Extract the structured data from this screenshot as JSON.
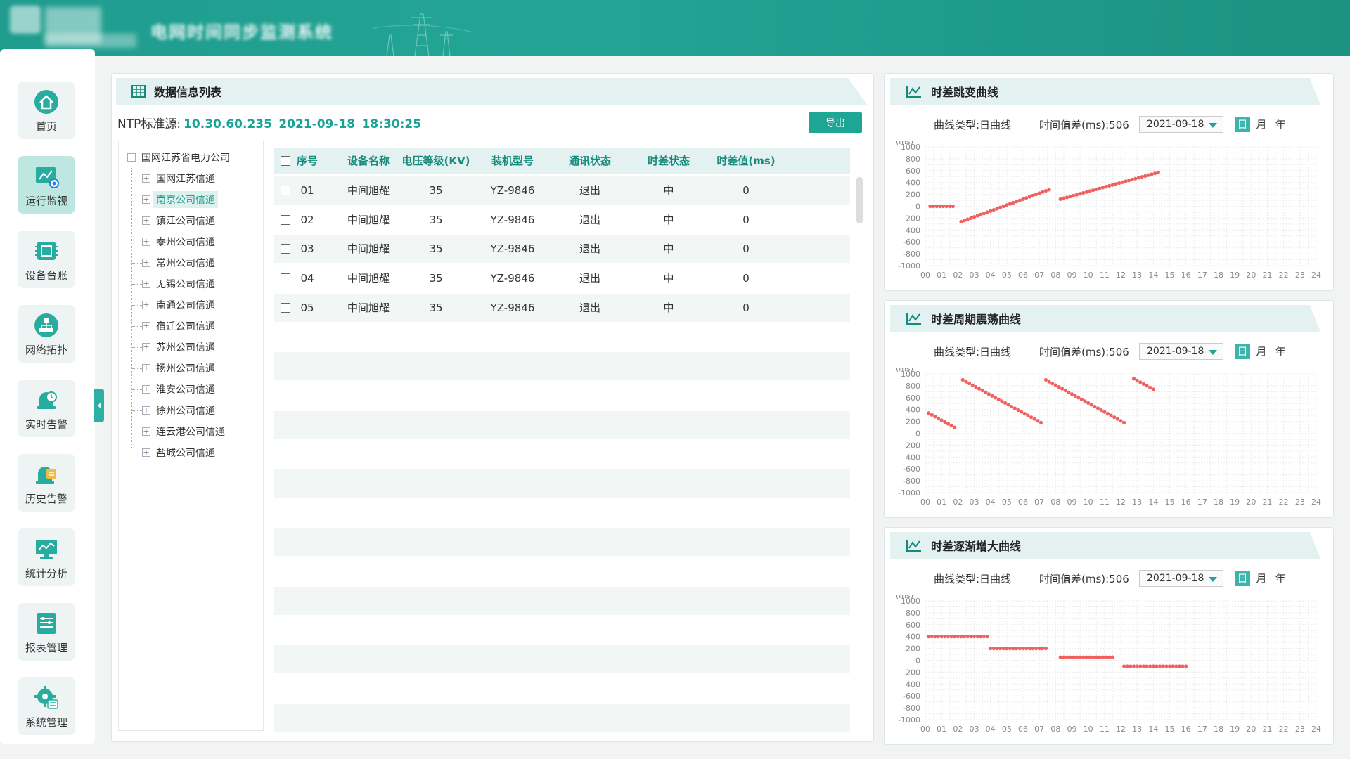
{
  "header": {
    "system_title": "电网时间同步监测系统"
  },
  "nav": {
    "items": [
      {
        "label": "首页",
        "icon": "home-icon",
        "active": false
      },
      {
        "label": "运行监视",
        "icon": "monitor-chart-icon",
        "active": true
      },
      {
        "label": "设备台账",
        "icon": "chip-icon",
        "active": false
      },
      {
        "label": "网络拓扑",
        "icon": "topology-icon",
        "active": false
      },
      {
        "label": "实时告警",
        "icon": "alarm-bell-icon",
        "active": false
      },
      {
        "label": "历史告警",
        "icon": "history-alarm-icon",
        "active": false
      },
      {
        "label": "统计分析",
        "icon": "trend-monitor-icon",
        "active": false
      },
      {
        "label": "报表管理",
        "icon": "report-icon",
        "active": false
      },
      {
        "label": "系统管理",
        "icon": "settings-gear-icon",
        "active": false
      }
    ]
  },
  "list_panel": {
    "title": "数据信息列表",
    "ntp_label": "NTP标准源:",
    "ntp_ip": "10.30.60.235",
    "ntp_date": "2021-09-18",
    "ntp_time": "18:30:25",
    "export_label": "导出"
  },
  "tree": {
    "root": "国网江苏省电力公司",
    "children": [
      "国网江苏信通",
      "南京公司信通",
      "镇江公司信通",
      "泰州公司信通",
      "常州公司信通",
      "无锡公司信通",
      "南通公司信通",
      "宿迁公司信通",
      "苏州公司信通",
      "扬州公司信通",
      "淮安公司信通",
      "徐州公司信通",
      "连云港公司信通",
      "盐城公司信通"
    ],
    "selected_index": 1
  },
  "table": {
    "columns": [
      "序号",
      "设备名称",
      "电压等级(KV)",
      "装机型号",
      "通讯状态",
      "时差状态",
      "时差值(ms)"
    ],
    "rows": [
      [
        "01",
        "中间旭耀",
        "35",
        "YZ-9846",
        "退出",
        "中",
        "0"
      ],
      [
        "02",
        "中间旭耀",
        "35",
        "YZ-9846",
        "退出",
        "中",
        "0"
      ],
      [
        "03",
        "中间旭耀",
        "35",
        "YZ-9846",
        "退出",
        "中",
        "0"
      ],
      [
        "04",
        "中间旭耀",
        "35",
        "YZ-9846",
        "退出",
        "中",
        "0"
      ],
      [
        "05",
        "中间旭耀",
        "35",
        "YZ-9846",
        "退出",
        "中",
        "0"
      ]
    ]
  },
  "charts_common": {
    "curve_type_label": "曲线类型:日曲线",
    "offset_label": "时间偏差(ms):506",
    "date_value": "2021-09-18",
    "day": "日",
    "month": "月",
    "year": "年",
    "unit": "(ms)",
    "accent": "#1da596",
    "point_color": "#f06060"
  },
  "chart_data": [
    {
      "type": "scatter",
      "title": "时差跳变曲线",
      "ylabel": "(ms)",
      "ylim": [
        -1000,
        1000
      ],
      "yticks": [
        1000,
        800,
        600,
        400,
        200,
        0,
        -200,
        -400,
        -600,
        -800,
        -1000
      ],
      "xticks": [
        "00",
        "01",
        "02",
        "03",
        "04",
        "05",
        "06",
        "07",
        "08",
        "09",
        "10",
        "11",
        "12",
        "13",
        "14",
        "15",
        "16",
        "17",
        "18",
        "19",
        "20",
        "21",
        "22",
        "23",
        "24"
      ],
      "grid": true,
      "series": [
        {
          "x": [
            0.3,
            0.5,
            0.7,
            0.9,
            1.1,
            1.3,
            1.5,
            1.7,
            2.2,
            2.4,
            2.6,
            2.8,
            3.0,
            3.2,
            3.4,
            3.6,
            3.8,
            4.0,
            4.2,
            4.4,
            4.6,
            4.8,
            5.0,
            5.2,
            5.4,
            5.6,
            5.8,
            6.0,
            6.2,
            6.4,
            6.6,
            6.8,
            7.0,
            7.2,
            7.4,
            7.6,
            8.3,
            8.5,
            8.7,
            8.9,
            9.1,
            9.3,
            9.5,
            9.7,
            9.9,
            10.1,
            10.3,
            10.5,
            10.7,
            10.9,
            11.1,
            11.3,
            11.5,
            11.7,
            11.9,
            12.1,
            12.3,
            12.5,
            12.7,
            12.9,
            13.1,
            13.3,
            13.5,
            13.7,
            13.9,
            14.1,
            14.3
          ],
          "y": [
            0,
            0,
            0,
            0,
            0,
            0,
            0,
            0,
            -260,
            -240,
            -220,
            -200,
            -180,
            -160,
            -140,
            -120,
            -100,
            -80,
            -60,
            -40,
            -20,
            0,
            20,
            40,
            60,
            80,
            100,
            120,
            140,
            160,
            180,
            200,
            220,
            240,
            260,
            280,
            120,
            135,
            150,
            165,
            180,
            195,
            210,
            225,
            240,
            255,
            270,
            285,
            300,
            315,
            330,
            345,
            360,
            375,
            390,
            405,
            420,
            435,
            450,
            465,
            480,
            495,
            510,
            525,
            540,
            555,
            570
          ]
        }
      ]
    },
    {
      "type": "scatter",
      "title": "时差周期震荡曲线",
      "ylabel": "(ms)",
      "ylim": [
        -1000,
        1000
      ],
      "yticks": [
        1000,
        800,
        600,
        400,
        200,
        0,
        -200,
        -400,
        -600,
        -800,
        -1000
      ],
      "xticks": [
        "00",
        "01",
        "02",
        "03",
        "04",
        "05",
        "06",
        "07",
        "08",
        "09",
        "10",
        "11",
        "12",
        "13",
        "14",
        "15",
        "16",
        "17",
        "18",
        "19",
        "20",
        "21",
        "22",
        "23",
        "24"
      ],
      "grid": true,
      "series": [
        {
          "x": [
            0.2,
            0.4,
            0.6,
            0.8,
            1.0,
            1.2,
            1.4,
            1.6,
            1.8,
            2.3,
            2.5,
            2.7,
            2.9,
            3.1,
            3.3,
            3.5,
            3.7,
            3.9,
            4.1,
            4.3,
            4.5,
            4.7,
            4.9,
            5.1,
            5.3,
            5.5,
            5.7,
            5.9,
            6.1,
            6.3,
            6.5,
            6.7,
            6.9,
            7.1,
            7.4,
            7.6,
            7.8,
            8.0,
            8.2,
            8.4,
            8.6,
            8.8,
            9.0,
            9.2,
            9.4,
            9.6,
            9.8,
            10.0,
            10.2,
            10.4,
            10.6,
            10.8,
            11.0,
            11.2,
            11.4,
            11.6,
            11.8,
            12.0,
            12.2,
            12.8,
            13.0,
            13.2,
            13.4,
            13.6,
            13.8,
            14.0
          ],
          "y": [
            340,
            310,
            280,
            250,
            220,
            190,
            160,
            130,
            100,
            900,
            870,
            840,
            810,
            780,
            750,
            720,
            690,
            660,
            630,
            600,
            570,
            540,
            510,
            480,
            450,
            420,
            390,
            360,
            330,
            300,
            270,
            240,
            210,
            180,
            900,
            870,
            840,
            810,
            780,
            750,
            720,
            690,
            660,
            630,
            600,
            570,
            540,
            510,
            480,
            450,
            420,
            390,
            360,
            330,
            300,
            270,
            240,
            210,
            180,
            920,
            890,
            860,
            830,
            800,
            770,
            740
          ]
        }
      ]
    },
    {
      "type": "scatter",
      "title": "时差逐渐增大曲线",
      "ylabel": "(ms)",
      "ylim": [
        -1000,
        1000
      ],
      "yticks": [
        1000,
        800,
        600,
        400,
        200,
        0,
        -200,
        -400,
        -600,
        -800,
        -1000
      ],
      "xticks": [
        "00",
        "01",
        "02",
        "03",
        "04",
        "05",
        "06",
        "07",
        "08",
        "09",
        "10",
        "11",
        "12",
        "13",
        "14",
        "15",
        "16",
        "17",
        "18",
        "19",
        "20",
        "21",
        "22",
        "23",
        "24"
      ],
      "grid": true,
      "series": [
        {
          "x": [
            0.2,
            0.4,
            0.6,
            0.8,
            1.0,
            1.2,
            1.4,
            1.6,
            1.8,
            2.0,
            2.2,
            2.4,
            2.6,
            2.8,
            3.0,
            3.2,
            3.4,
            3.6,
            3.8,
            4.0,
            4.2,
            4.4,
            4.6,
            4.8,
            5.0,
            5.2,
            5.4,
            5.6,
            5.8,
            6.0,
            6.2,
            6.4,
            6.6,
            6.8,
            7.0,
            7.2,
            7.4,
            8.3,
            8.5,
            8.7,
            8.9,
            9.1,
            9.3,
            9.5,
            9.7,
            9.9,
            10.1,
            10.3,
            10.5,
            10.7,
            10.9,
            11.1,
            11.3,
            11.5,
            12.2,
            12.4,
            12.6,
            12.8,
            13.0,
            13.2,
            13.4,
            13.6,
            13.8,
            14.0,
            14.2,
            14.4,
            14.6,
            14.8,
            15.0,
            15.2,
            15.4,
            15.6,
            15.8,
            16.0
          ],
          "y": [
            400,
            400,
            400,
            400,
            400,
            400,
            400,
            400,
            400,
            400,
            400,
            400,
            400,
            400,
            400,
            400,
            400,
            400,
            400,
            200,
            200,
            200,
            200,
            200,
            200,
            200,
            200,
            200,
            200,
            200,
            200,
            200,
            200,
            200,
            200,
            200,
            200,
            50,
            50,
            50,
            50,
            50,
            50,
            50,
            50,
            50,
            50,
            50,
            50,
            50,
            50,
            50,
            50,
            50,
            -100,
            -100,
            -100,
            -100,
            -100,
            -100,
            -100,
            -100,
            -100,
            -100,
            -100,
            -100,
            -100,
            -100,
            -100,
            -100,
            -100,
            -100,
            -100,
            -100
          ]
        }
      ]
    }
  ]
}
